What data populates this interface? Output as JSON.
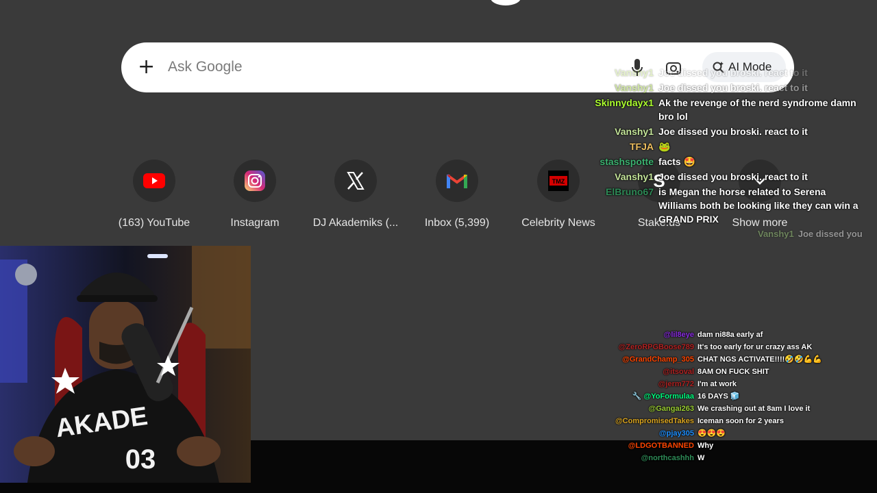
{
  "search": {
    "placeholder": "Ask Google",
    "ai_mode_label": "AI Mode"
  },
  "shortcuts": [
    {
      "label": "(163) YouTube",
      "icon": "youtube-icon",
      "color": "#ff0000"
    },
    {
      "label": "Instagram",
      "icon": "instagram-icon",
      "color": "#e1306c"
    },
    {
      "label": "DJ Akademiks (...",
      "icon": "x-icon",
      "color": "#ffffff"
    },
    {
      "label": "Inbox (5,399)",
      "icon": "gmail-icon",
      "color": "#ea4335"
    },
    {
      "label": "Celebrity News",
      "icon": "tmz-icon",
      "color": "#d40000"
    },
    {
      "label": "Stake.us",
      "icon": "stake-icon",
      "color": "#ffffff"
    },
    {
      "label": "Show more",
      "icon": "show-more-icon",
      "color": "#ffffff"
    }
  ],
  "chat_top": [
    {
      "user": "Vanshy1",
      "message": "Joe dissed you broski. react to it",
      "color": "#9acd32",
      "faded": true
    },
    {
      "user": "Vanshy1",
      "message": "Joe dissed you broski. react to it",
      "color": "#9acd32",
      "faded": true
    },
    {
      "user": "Skinnydayx1",
      "message": "Ak the revenge of the nerd syndrome damn bro lol",
      "color": "#adff2f"
    },
    {
      "user": "Vanshy1",
      "message": "Joe dissed you broski. react to it",
      "color": "#c5e69a"
    },
    {
      "user": "TFJA",
      "message": "🐸",
      "color": "#f0c060"
    },
    {
      "user": "stashspotte",
      "message": "facts 🤩",
      "color": "#3cb371"
    },
    {
      "user": "Vanshy1",
      "message": "Joe dissed you broski. react to it",
      "color": "#c5e69a"
    },
    {
      "user": "ElBruno67",
      "message": "is Megan the horse related to Serena Williams both be looking like they can win a GRAND PRIX",
      "color": "#2e8b57"
    }
  ],
  "chat_trail": {
    "user": "Vanshy1",
    "message": "Joe dissed you"
  },
  "chat_bottom": [
    {
      "user": "@lil8eye",
      "message": "dam ni88a early af",
      "color": "#8a2be2"
    },
    {
      "user": "@ZeroRPGBoose789",
      "message": "It's too early for ur crazy ass AK",
      "color": "#b22222"
    },
    {
      "user": "@GrandChamp_305",
      "message": "CHAT NGS ACTIVATE!!!!🤣🤣💪💪",
      "color": "#ff4500"
    },
    {
      "user": "@itsoval",
      "message": "8AM ON FUCK SHIT",
      "color": "#b22222"
    },
    {
      "user": "@jerm772",
      "message": "I'm at work",
      "color": "#b22222"
    },
    {
      "user": "@YoFormulaa",
      "message": "16 DAYS 🧊",
      "color": "#00ff7f",
      "badge": "🔧"
    },
    {
      "user": "@Gangai263",
      "message": "We crashing out at 8am I love it",
      "color": "#9acd32"
    },
    {
      "user": "@CompromisedTakes",
      "message": "Iceman soon for 2 years",
      "color": "#daa520"
    },
    {
      "user": "@pjay305",
      "message": "😍😍😍",
      "color": "#1e90ff"
    },
    {
      "user": "@LDGOTBANNED",
      "message": "Why",
      "color": "#ff4500"
    },
    {
      "user": "@northcashhh",
      "message": "W",
      "color": "#2e8b57"
    }
  ],
  "webcam": {
    "jersey_text": "AKADE",
    "jersey_number": "03"
  }
}
